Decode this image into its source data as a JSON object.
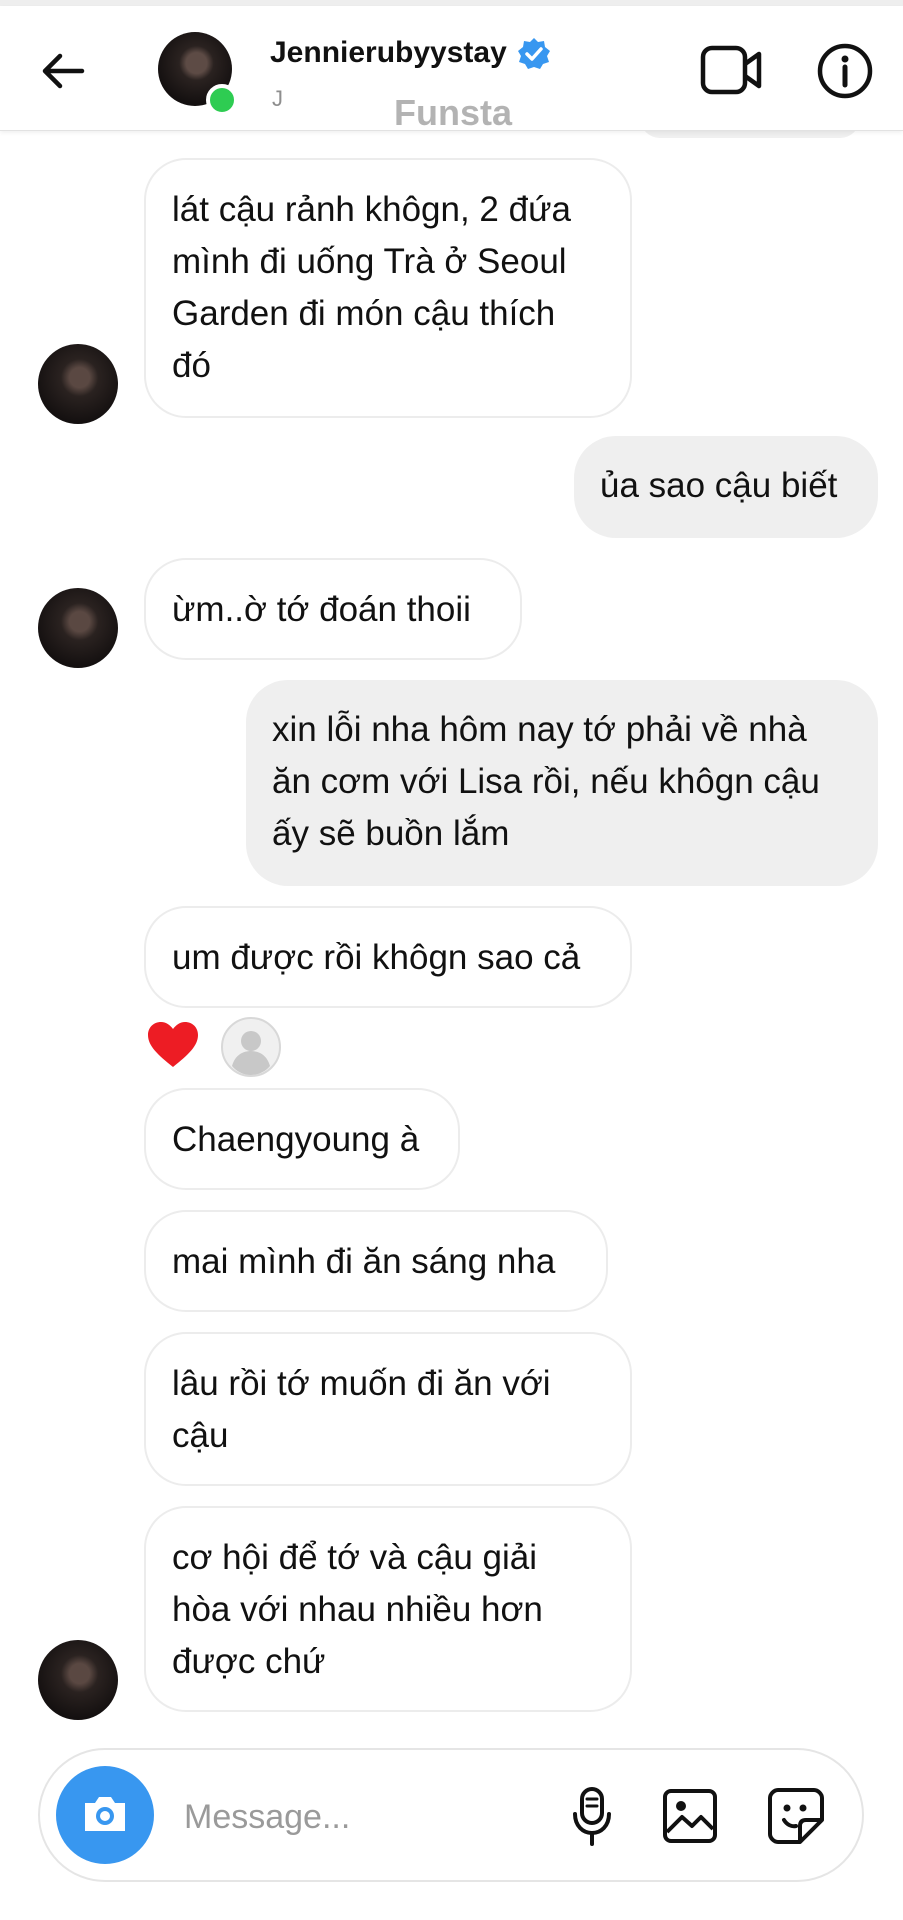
{
  "header": {
    "name": "Jennierubyystay",
    "sub": "J",
    "overlay": "Funsta"
  },
  "icons": {
    "back": "arrow-left-icon",
    "verified": "verified-badge-icon",
    "video": "video-camera-icon",
    "info": "info-icon",
    "camera": "camera-icon",
    "mic": "microphone-icon",
    "gallery": "image-icon",
    "sticker": "sticker-icon",
    "reaction": "heart-icon"
  },
  "colors": {
    "accent": "#3897f0",
    "online": "#2ecc52",
    "heart": "#ed1c24",
    "outgoing_bubble": "#efefef"
  },
  "messages": [
    {
      "side": "in",
      "lines": [
        "lát cậu rảnh khôgn, 2 đứa",
        "mình đi uống Trà ở Seoul",
        "Garden đi món cậu thích",
        "đó"
      ]
    },
    {
      "side": "out",
      "lines": [
        "ủa sao cậu biết"
      ]
    },
    {
      "side": "in",
      "lines": [
        "ừm..ờ tớ đoán thoii"
      ]
    },
    {
      "side": "out",
      "lines": [
        "xin lỗi nha hôm nay tớ phải về nhà",
        "ăn cơm với Lisa rồi, nếu khôgn cậu",
        "ấy sẽ buồn lắm"
      ]
    },
    {
      "side": "in",
      "lines": [
        "um được rồi khôgn sao cả"
      ]
    },
    {
      "side": "in",
      "lines": [
        "Chaengyoung à"
      ]
    },
    {
      "side": "in",
      "lines": [
        "mai mình đi ăn sáng nha"
      ]
    },
    {
      "side": "in",
      "lines": [
        "lâu rồi tớ muốn đi ăn với",
        "cậu"
      ]
    },
    {
      "side": "in",
      "lines": [
        "cơ hội để tớ và cậu giải",
        "hòa với nhau nhiều hơn",
        "được chứ"
      ]
    }
  ],
  "composer": {
    "placeholder": "Message..."
  }
}
